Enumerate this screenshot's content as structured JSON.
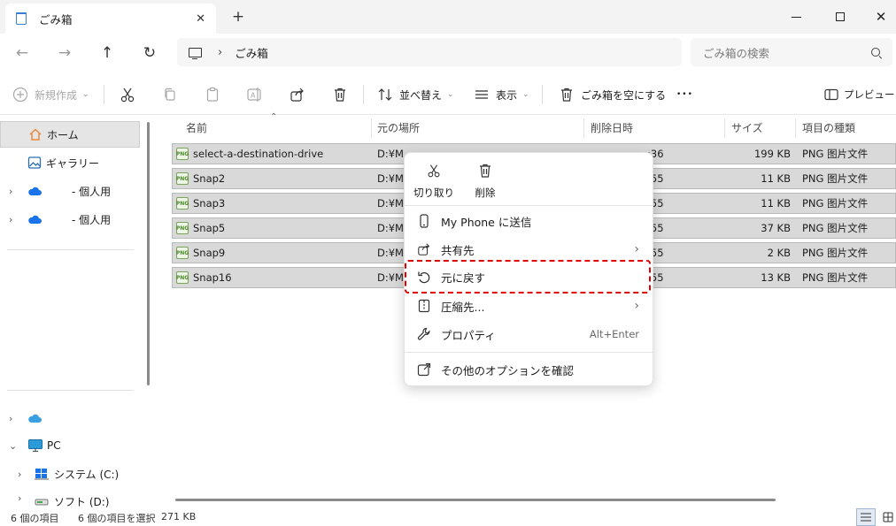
{
  "window": {
    "tab_title": "ごみ箱",
    "close_tab_symbol": "✕",
    "new_tab_symbol": "+",
    "close_symbol": "✕"
  },
  "nav": {
    "back": "←",
    "forward": "→",
    "up": "↑",
    "refresh": "↻"
  },
  "address": {
    "separator": "›",
    "crumb": "ごみ箱"
  },
  "search": {
    "placeholder": "ごみ箱の検索"
  },
  "toolbar": {
    "new_label": "新規作成",
    "sort_label": "並べ替え",
    "view_label": "表示",
    "empty_label": "ごみ箱を空にする",
    "more_label": "•••",
    "preview_label": "プレビュー",
    "chevron": "⌄"
  },
  "sidebar": {
    "items": [
      {
        "label": "ホーム"
      },
      {
        "label": "ギャラリー"
      },
      {
        "label": "- 個人用"
      },
      {
        "label": "- 個人用"
      },
      {
        "label": ""
      },
      {
        "label": "PC"
      },
      {
        "label": "システム (C:)"
      },
      {
        "label": "ソフト (D:)"
      }
    ],
    "chev_right": "›",
    "chev_down": "⌄"
  },
  "columns": {
    "name": "名前",
    "location": "元の場所",
    "deleted": "削除日時",
    "size": "サイズ",
    "type": "項目の種類",
    "sort_arrow": "⌃"
  },
  "files": [
    {
      "name": "select-a-destination-drive",
      "location": "D:¥M",
      "deleted": ":36",
      "size": "199 KB",
      "type": "PNG 图片文件"
    },
    {
      "name": "Snap2",
      "location": "D:¥M",
      "deleted": ":55",
      "size": "11 KB",
      "type": "PNG 图片文件"
    },
    {
      "name": "Snap3",
      "location": "D:¥M",
      "deleted": ":55",
      "size": "11 KB",
      "type": "PNG 图片文件"
    },
    {
      "name": "Snap5",
      "location": "D:¥M",
      "deleted": ":55",
      "size": "37 KB",
      "type": "PNG 图片文件"
    },
    {
      "name": "Snap9",
      "location": "D:¥M",
      "deleted": ":55",
      "size": "2 KB",
      "type": "PNG 图片文件"
    },
    {
      "name": "Snap16",
      "location": "D:¥M",
      "deleted": ":55",
      "size": "13 KB",
      "type": "PNG 图片文件"
    }
  ],
  "file_icon_text": "PNG",
  "context_menu": {
    "cut_label": "切り取り",
    "delete_label": "削除",
    "items": [
      {
        "label": "My Phone に送信",
        "right": ""
      },
      {
        "label": "共有先",
        "right": "›"
      },
      {
        "label": "元に戻す",
        "right": ""
      },
      {
        "label": "圧縮先...",
        "right": "›"
      },
      {
        "label": "プロパティ",
        "right": "Alt+Enter"
      },
      {
        "label": "その他のオプションを確認",
        "right": ""
      }
    ]
  },
  "status": {
    "count": "6 個の項目",
    "selected": "6 個の項目を選択",
    "size": "271 KB"
  },
  "colors": {
    "accent": "#3b7fd0",
    "highlight": "#e00000",
    "selected_row": "#d9d9d9",
    "onedrive": "#1a73e8",
    "home_icon": "#e8893a"
  }
}
